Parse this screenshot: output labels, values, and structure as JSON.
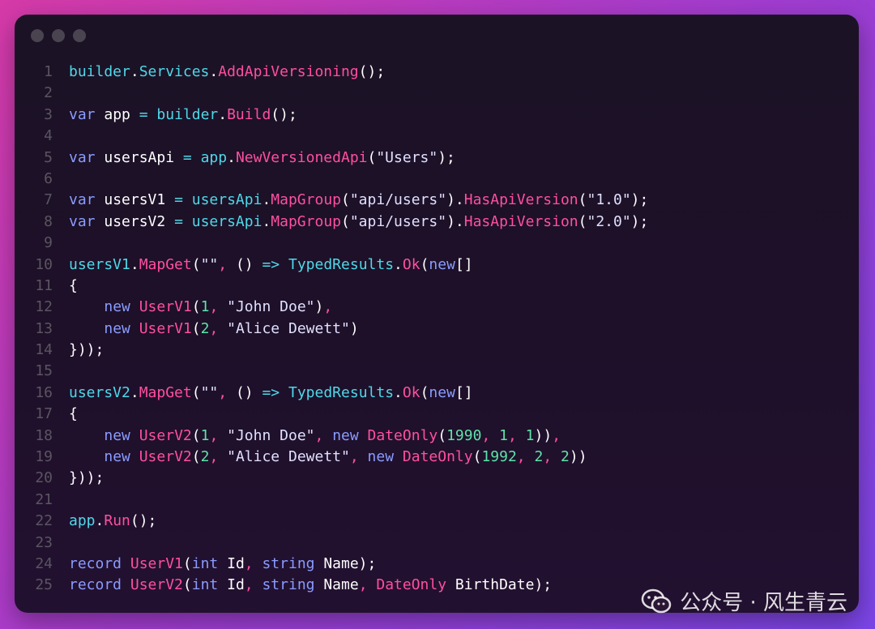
{
  "window": {
    "controls": [
      "close",
      "minimize",
      "zoom"
    ]
  },
  "code": {
    "lines": [
      {
        "n": "1",
        "tokens": [
          [
            "id",
            "builder"
          ],
          [
            "p",
            "."
          ],
          [
            "id",
            "Services"
          ],
          [
            "p",
            "."
          ],
          [
            "meth",
            "AddApiVersioning"
          ],
          [
            "p",
            "();"
          ]
        ]
      },
      {
        "n": "2",
        "tokens": []
      },
      {
        "n": "3",
        "tokens": [
          [
            "kw",
            "var"
          ],
          [
            "p",
            " app "
          ],
          [
            "op",
            "="
          ],
          [
            "p",
            " "
          ],
          [
            "id",
            "builder"
          ],
          [
            "p",
            "."
          ],
          [
            "meth",
            "Build"
          ],
          [
            "p",
            "();"
          ]
        ]
      },
      {
        "n": "4",
        "tokens": []
      },
      {
        "n": "5",
        "tokens": [
          [
            "kw",
            "var"
          ],
          [
            "p",
            " usersApi "
          ],
          [
            "op",
            "="
          ],
          [
            "p",
            " "
          ],
          [
            "id",
            "app"
          ],
          [
            "p",
            "."
          ],
          [
            "meth",
            "NewVersionedApi"
          ],
          [
            "p",
            "("
          ],
          [
            "str",
            "\"Users\""
          ],
          [
            "p",
            ");"
          ]
        ]
      },
      {
        "n": "6",
        "tokens": []
      },
      {
        "n": "7",
        "tokens": [
          [
            "kw",
            "var"
          ],
          [
            "p",
            " usersV1 "
          ],
          [
            "op",
            "="
          ],
          [
            "p",
            " "
          ],
          [
            "id",
            "usersApi"
          ],
          [
            "p",
            "."
          ],
          [
            "meth",
            "MapGroup"
          ],
          [
            "p",
            "("
          ],
          [
            "str",
            "\"api/users\""
          ],
          [
            "p",
            ")."
          ],
          [
            "meth",
            "HasApiVersion"
          ],
          [
            "p",
            "("
          ],
          [
            "str",
            "\"1.0\""
          ],
          [
            "p",
            ");"
          ]
        ]
      },
      {
        "n": "8",
        "tokens": [
          [
            "kw",
            "var"
          ],
          [
            "p",
            " usersV2 "
          ],
          [
            "op",
            "="
          ],
          [
            "p",
            " "
          ],
          [
            "id",
            "usersApi"
          ],
          [
            "p",
            "."
          ],
          [
            "meth",
            "MapGroup"
          ],
          [
            "p",
            "("
          ],
          [
            "str",
            "\"api/users\""
          ],
          [
            "p",
            ")."
          ],
          [
            "meth",
            "HasApiVersion"
          ],
          [
            "p",
            "("
          ],
          [
            "str",
            "\"2.0\""
          ],
          [
            "p",
            ");"
          ]
        ]
      },
      {
        "n": "9",
        "tokens": []
      },
      {
        "n": "10",
        "tokens": [
          [
            "id",
            "usersV1"
          ],
          [
            "p",
            "."
          ],
          [
            "meth",
            "MapGet"
          ],
          [
            "p",
            "("
          ],
          [
            "str",
            "\"\""
          ],
          [
            "mut",
            ", "
          ],
          [
            "p",
            "() "
          ],
          [
            "op",
            "=>"
          ],
          [
            "p",
            " "
          ],
          [
            "id",
            "TypedResults"
          ],
          [
            "p",
            "."
          ],
          [
            "meth",
            "Ok"
          ],
          [
            "p",
            "("
          ],
          [
            "kw",
            "new"
          ],
          [
            "p",
            "[]"
          ]
        ]
      },
      {
        "n": "11",
        "tokens": [
          [
            "p",
            "{"
          ]
        ]
      },
      {
        "n": "12",
        "tokens": [
          [
            "p",
            "    "
          ],
          [
            "kw",
            "new"
          ],
          [
            "p",
            " "
          ],
          [
            "meth",
            "UserV1"
          ],
          [
            "p",
            "("
          ],
          [
            "num",
            "1"
          ],
          [
            "mut",
            ", "
          ],
          [
            "str",
            "\"John Doe\""
          ],
          [
            "p",
            ")"
          ],
          [
            "mut",
            ","
          ]
        ]
      },
      {
        "n": "13",
        "tokens": [
          [
            "p",
            "    "
          ],
          [
            "kw",
            "new"
          ],
          [
            "p",
            " "
          ],
          [
            "meth",
            "UserV1"
          ],
          [
            "p",
            "("
          ],
          [
            "num",
            "2"
          ],
          [
            "mut",
            ", "
          ],
          [
            "str",
            "\"Alice Dewett\""
          ],
          [
            "p",
            ")"
          ]
        ]
      },
      {
        "n": "14",
        "tokens": [
          [
            "p",
            "}));"
          ]
        ]
      },
      {
        "n": "15",
        "tokens": []
      },
      {
        "n": "16",
        "tokens": [
          [
            "id",
            "usersV2"
          ],
          [
            "p",
            "."
          ],
          [
            "meth",
            "MapGet"
          ],
          [
            "p",
            "("
          ],
          [
            "str",
            "\"\""
          ],
          [
            "mut",
            ", "
          ],
          [
            "p",
            "() "
          ],
          [
            "op",
            "=>"
          ],
          [
            "p",
            " "
          ],
          [
            "id",
            "TypedResults"
          ],
          [
            "p",
            "."
          ],
          [
            "meth",
            "Ok"
          ],
          [
            "p",
            "("
          ],
          [
            "kw",
            "new"
          ],
          [
            "p",
            "[]"
          ]
        ]
      },
      {
        "n": "17",
        "tokens": [
          [
            "p",
            "{"
          ]
        ]
      },
      {
        "n": "18",
        "tokens": [
          [
            "p",
            "    "
          ],
          [
            "kw",
            "new"
          ],
          [
            "p",
            " "
          ],
          [
            "meth",
            "UserV2"
          ],
          [
            "p",
            "("
          ],
          [
            "num",
            "1"
          ],
          [
            "mut",
            ", "
          ],
          [
            "str",
            "\"John Doe\""
          ],
          [
            "mut",
            ", "
          ],
          [
            "kw",
            "new"
          ],
          [
            "p",
            " "
          ],
          [
            "meth",
            "DateOnly"
          ],
          [
            "p",
            "("
          ],
          [
            "num",
            "1990"
          ],
          [
            "mut",
            ", "
          ],
          [
            "num",
            "1"
          ],
          [
            "mut",
            ", "
          ],
          [
            "num",
            "1"
          ],
          [
            "p",
            "))"
          ],
          [
            "mut",
            ","
          ]
        ]
      },
      {
        "n": "19",
        "tokens": [
          [
            "p",
            "    "
          ],
          [
            "kw",
            "new"
          ],
          [
            "p",
            " "
          ],
          [
            "meth",
            "UserV2"
          ],
          [
            "p",
            "("
          ],
          [
            "num",
            "2"
          ],
          [
            "mut",
            ", "
          ],
          [
            "str",
            "\"Alice Dewett\""
          ],
          [
            "mut",
            ", "
          ],
          [
            "kw",
            "new"
          ],
          [
            "p",
            " "
          ],
          [
            "meth",
            "DateOnly"
          ],
          [
            "p",
            "("
          ],
          [
            "num",
            "1992"
          ],
          [
            "mut",
            ", "
          ],
          [
            "num",
            "2"
          ],
          [
            "mut",
            ", "
          ],
          [
            "num",
            "2"
          ],
          [
            "p",
            "))"
          ]
        ]
      },
      {
        "n": "20",
        "tokens": [
          [
            "p",
            "}));"
          ]
        ]
      },
      {
        "n": "21",
        "tokens": []
      },
      {
        "n": "22",
        "tokens": [
          [
            "id",
            "app"
          ],
          [
            "p",
            "."
          ],
          [
            "meth",
            "Run"
          ],
          [
            "p",
            "();"
          ]
        ]
      },
      {
        "n": "23",
        "tokens": []
      },
      {
        "n": "24",
        "tokens": [
          [
            "kw",
            "record"
          ],
          [
            "p",
            " "
          ],
          [
            "meth",
            "UserV1"
          ],
          [
            "p",
            "("
          ],
          [
            "kw",
            "int"
          ],
          [
            "p",
            " Id"
          ],
          [
            "mut",
            ", "
          ],
          [
            "kw",
            "string"
          ],
          [
            "p",
            " Name);"
          ]
        ]
      },
      {
        "n": "25",
        "tokens": [
          [
            "kw",
            "record"
          ],
          [
            "p",
            " "
          ],
          [
            "meth",
            "UserV2"
          ],
          [
            "p",
            "("
          ],
          [
            "kw",
            "int"
          ],
          [
            "p",
            " Id"
          ],
          [
            "mut",
            ", "
          ],
          [
            "kw",
            "string"
          ],
          [
            "p",
            " Name"
          ],
          [
            "mut",
            ", "
          ],
          [
            "meth",
            "DateOnly"
          ],
          [
            "p",
            " BirthDate);"
          ]
        ]
      }
    ]
  },
  "watermark": {
    "text": "公众号 · 风生青云",
    "icon": "wechat-icon"
  },
  "colors": {
    "keyword": "#8a9cff",
    "identifier": "#4fd8e8",
    "method": "#ff4fa0",
    "number": "#5ee3a8",
    "string": "#e0e0ff"
  }
}
